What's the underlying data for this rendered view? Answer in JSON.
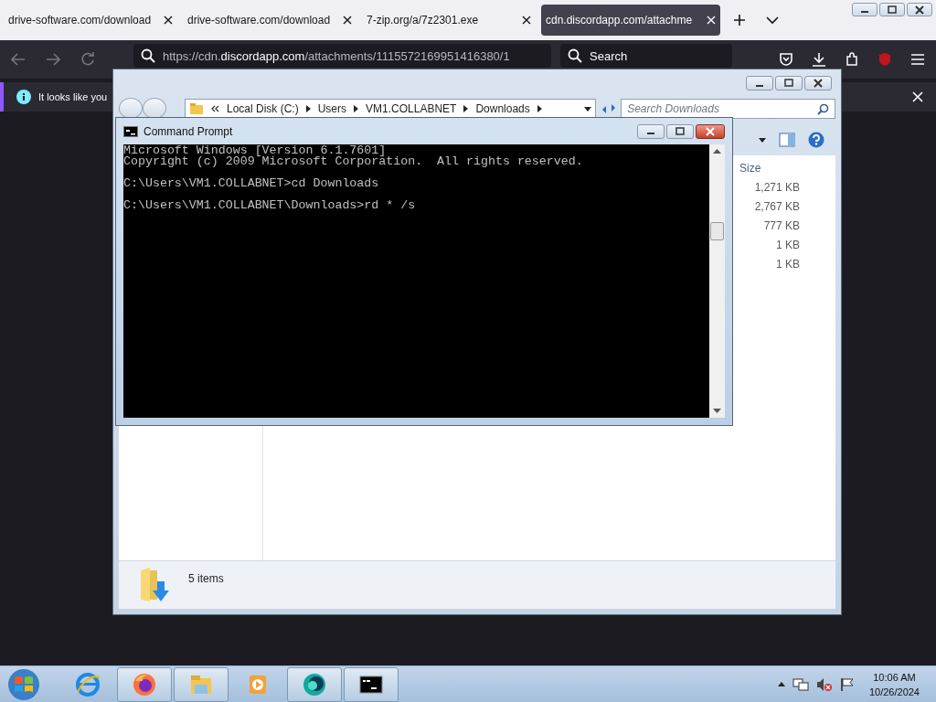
{
  "browser": {
    "tabs": [
      {
        "label": "drive-software.com/download",
        "selected": false
      },
      {
        "label": "drive-software.com/download",
        "selected": false
      },
      {
        "label": "7-zip.org/a/7z2301.exe",
        "selected": false
      },
      {
        "label": "cdn.discordapp.com/attachme",
        "selected": true
      }
    ],
    "address": "https://cdn.discordapp.com/attachments/1115572169951416380/1",
    "search_placeholder": "Search",
    "notification": "It looks like you"
  },
  "explorer": {
    "breadcrumb": [
      "Local Disk (C:)",
      "Users",
      "VM1.COLLABNET",
      "Downloads"
    ],
    "search_placeholder": "Search Downloads",
    "column": "Size",
    "sizes": [
      "1,271 KB",
      "2,767 KB",
      "777 KB",
      "1 KB",
      "1 KB"
    ],
    "status": "5 items"
  },
  "cmd": {
    "title": "Command Prompt",
    "paragraphs": [
      [
        "Microsoft Windows [Version 6.1.7601]",
        "Copyright (c) 2009 Microsoft Corporation.  All rights reserved."
      ],
      [
        "C:\\Users\\VM1.COLLABNET>cd Downloads"
      ],
      [
        "C:\\Users\\VM1.COLLABNET\\Downloads>rd * /s"
      ]
    ]
  },
  "taskbar": {
    "buttons": [
      {
        "running": false
      },
      {
        "running": true
      },
      {
        "running": true
      },
      {
        "running": false
      },
      {
        "running": true
      },
      {
        "running": true
      }
    ],
    "time": "10:06 AM",
    "date": "10/26/2024"
  }
}
